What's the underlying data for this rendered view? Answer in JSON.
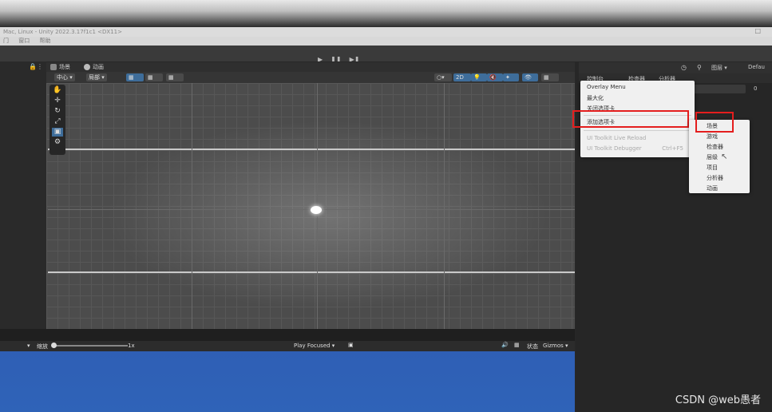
{
  "window": {
    "title": "Mac, Linux - Unity 2022.3.17f1c1 <DX11>",
    "menu": [
      "门",
      "窗口",
      "帮助"
    ]
  },
  "play_controls": {
    "play": "▶",
    "pause": "❚❚",
    "step": "▶❚"
  },
  "scene_tabs": [
    {
      "label": "场景",
      "icon": "grid-icon"
    },
    {
      "label": "动画",
      "icon": "animation-icon"
    }
  ],
  "scene_toolbar": {
    "pivot": "中心",
    "space": "局部",
    "mode_2d": "2D"
  },
  "tools": [
    "✋",
    "✛",
    "↻",
    "⤢",
    "▣",
    "⚙"
  ],
  "right_header": {
    "layers": "图层",
    "layout": "Defau"
  },
  "right_tabs": [
    {
      "label": "控制台"
    },
    {
      "label": "检查器"
    },
    {
      "label": "分析器"
    }
  ],
  "right_count": "0",
  "context_menu": {
    "items": [
      {
        "label": "Overlay Menu",
        "disabled": false
      },
      {
        "label": "最大化",
        "disabled": false
      },
      {
        "label": "关闭选项卡",
        "disabled": false
      },
      {
        "label": "添加选项卡",
        "disabled": false
      },
      {
        "label": "UI Toolkit Live Reload",
        "disabled": true
      },
      {
        "label": "UI Toolkit Debugger",
        "disabled": true,
        "shortcut": "Ctrl+F5"
      }
    ]
  },
  "sub_menu": {
    "items": [
      "场景",
      "游戏",
      "检查器",
      "层级",
      "项目",
      "分析器",
      "动画"
    ]
  },
  "game_bar": {
    "scale_label": "缩放",
    "scale_value": "1x",
    "play_focused": "Play Focused",
    "stats": "状态",
    "gizmos": "Gizmos"
  },
  "watermark": "CSDN @web愚者"
}
